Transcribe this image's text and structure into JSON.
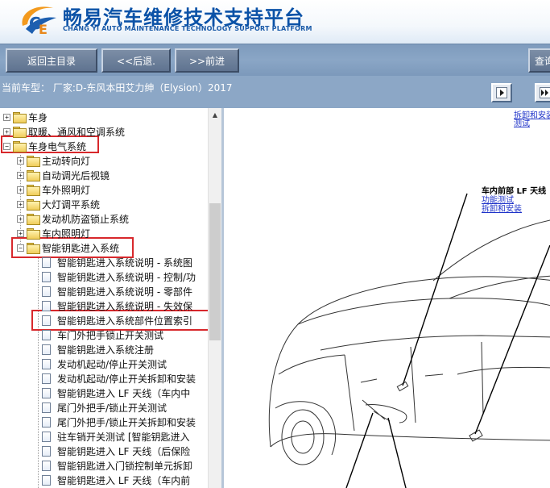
{
  "header": {
    "title": "畅易汽车维修技术支持平台",
    "subtitle": "CHANG YI AUTO MAINTENANCE TECHNOLOGY SUPPORT PLATFORM",
    "logo_icon": "ce-logo-swoosh"
  },
  "toolbar": {
    "back_main": "返回主目录",
    "prev": "<<后退.",
    "next": ">>前进",
    "query": "查询"
  },
  "infobar": {
    "vehicle": "当前车型： 厂家:D-东风本田艾力绅（Elysion）2017"
  },
  "tree": {
    "items": [
      {
        "label": "车身",
        "type": "folder",
        "expander": "+"
      },
      {
        "label": "取暖、通风和空调系统",
        "type": "folder",
        "expander": "+"
      },
      {
        "label": "车身电气系统",
        "type": "folder-open",
        "expander": "-"
      },
      {
        "label": "主动转向灯",
        "type": "folder",
        "expander": "+"
      },
      {
        "label": "自动调光后视镜",
        "type": "folder",
        "expander": "+"
      },
      {
        "label": "车外照明灯",
        "type": "folder",
        "expander": "+"
      },
      {
        "label": "大灯调平系统",
        "type": "folder",
        "expander": "+"
      },
      {
        "label": "发动机防盗锁止系统",
        "type": "folder",
        "expander": "+"
      },
      {
        "label": "车内照明灯",
        "type": "folder",
        "expander": "+"
      },
      {
        "label": "智能钥匙进入系统",
        "type": "folder-open",
        "expander": "-"
      },
      {
        "label": "智能钥匙进入系统说明 - 系统图",
        "type": "doc"
      },
      {
        "label": "智能钥匙进入系统说明 - 控制/功",
        "type": "doc"
      },
      {
        "label": "智能钥匙进入系统说明 - 零部件",
        "type": "doc"
      },
      {
        "label": "智能钥匙进入系统说明 - 失效保",
        "type": "doc"
      },
      {
        "label": "智能钥匙进入系统部件位置索引",
        "type": "doc"
      },
      {
        "label": "车门外把手锁止开关测试",
        "type": "doc"
      },
      {
        "label": "智能钥匙进入系统注册",
        "type": "doc"
      },
      {
        "label": "发动机起动/停止开关测试",
        "type": "doc"
      },
      {
        "label": "发动机起动/停止开关拆卸和安装",
        "type": "doc"
      },
      {
        "label": "智能钥匙进入 LF 天线（车内中",
        "type": "doc"
      },
      {
        "label": "尾门外把手/锁止开关测试",
        "type": "doc"
      },
      {
        "label": "尾门外把手/锁止开关拆卸和安装",
        "type": "doc"
      },
      {
        "label": "驻车销开关测试 [智能钥匙进入",
        "type": "doc"
      },
      {
        "label": "智能钥匙进入 LF 天线（后保险",
        "type": "doc"
      },
      {
        "label": "智能钥匙进入门锁控制单元拆卸",
        "type": "doc"
      },
      {
        "label": "智能钥匙进入 LF 天线（车内前",
        "type": "doc"
      }
    ]
  },
  "content": {
    "top_links": [
      "拆卸和安装",
      "测试"
    ],
    "callout_title": "车内前部 LF 天线",
    "callout_links": [
      "功能测试",
      "拆卸和安装"
    ]
  },
  "colors": {
    "brand_blue": "#0b52a7",
    "toolbar": "#8aa6c6",
    "highlight_red": "#d8282c",
    "link_blue": "#1f33c9"
  }
}
